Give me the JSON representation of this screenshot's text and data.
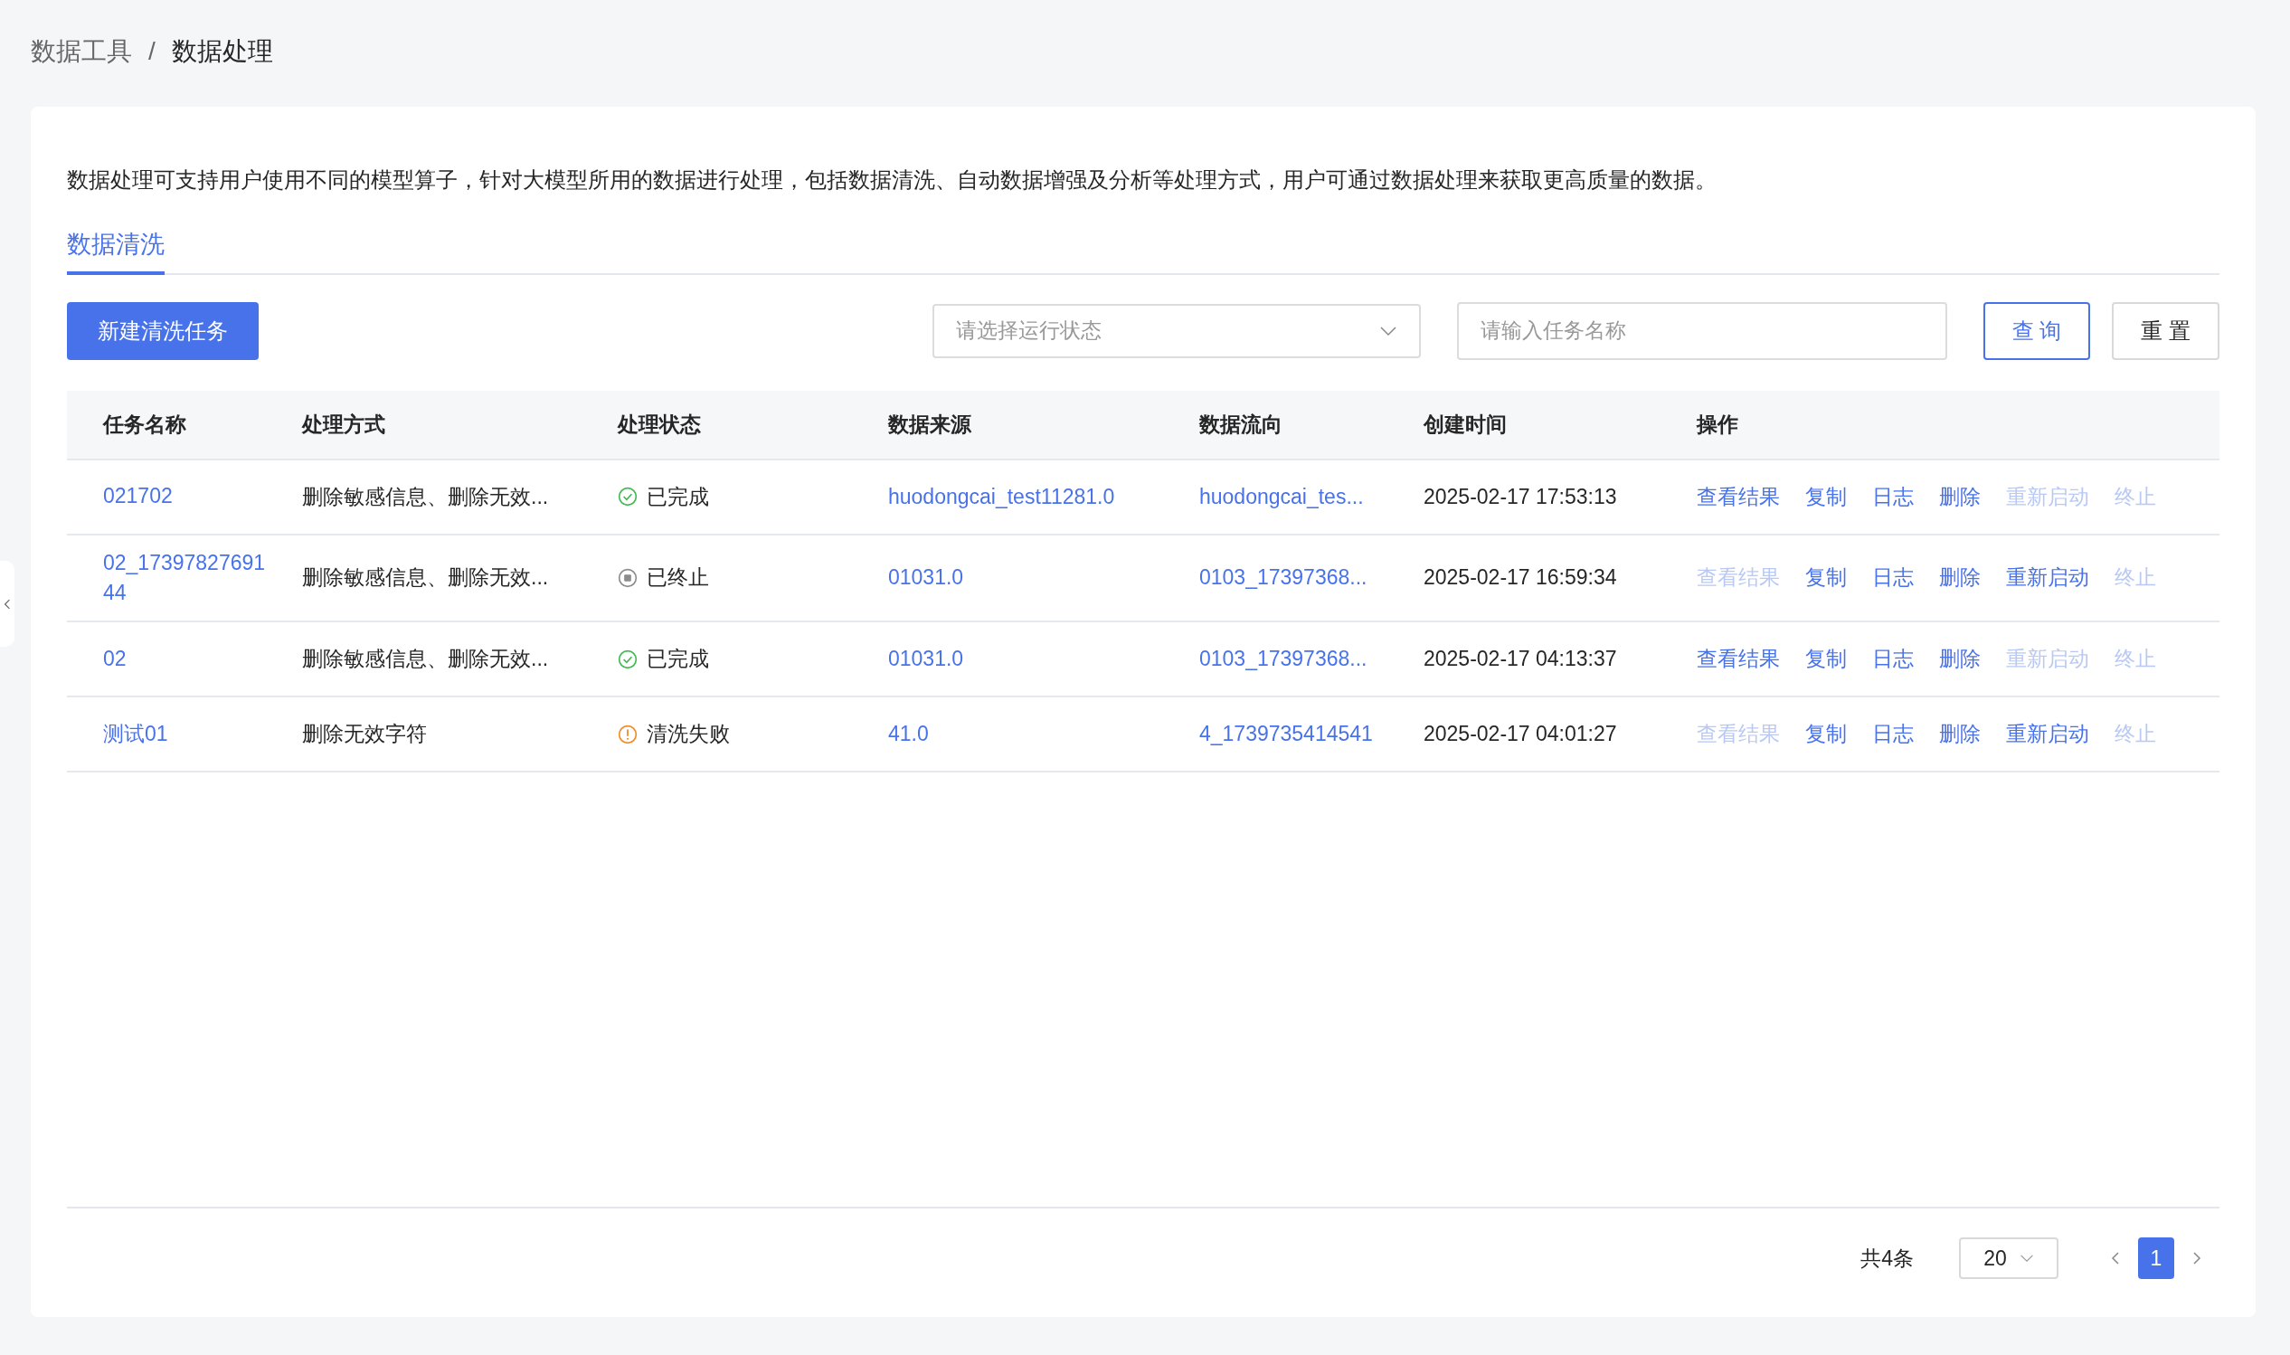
{
  "breadcrumb_separator": "/",
  "breadcrumb": [
    {
      "label": "数据工具",
      "current": false
    },
    {
      "label": "数据处理",
      "current": true
    }
  ],
  "description": "数据处理可支持用户使用不同的模型算子，针对大模型所用的数据进行处理，包括数据清洗、自动数据增强及分析等处理方式，用户可通过数据处理来获取更高质量的数据。",
  "tabs": [
    {
      "label": "数据清洗",
      "selected": true
    }
  ],
  "toolbar": {
    "create_button": "新建清洗任务",
    "status_select": {
      "placeholder": "请选择运行状态"
    },
    "name_search": {
      "placeholder": "请输入任务名称"
    },
    "query_button": "查 询",
    "reset_button": "重 置"
  },
  "table": {
    "columns": [
      "任务名称",
      "处理方式",
      "处理状态",
      "数据来源",
      "数据流向",
      "创建时间",
      "操作"
    ],
    "rows": [
      {
        "name": "021702",
        "method": "删除敏感信息、删除无效...",
        "status": {
          "kind": "done",
          "label": "已完成"
        },
        "source": "huodongcai_test11281.0",
        "target": "huodongcai_tes...",
        "created": "2025-02-17 17:53:13",
        "actions": [
          {
            "label": "查看结果",
            "disabled": false
          },
          {
            "label": "复制",
            "disabled": false
          },
          {
            "label": "日志",
            "disabled": false
          },
          {
            "label": "删除",
            "disabled": false
          },
          {
            "label": "重新启动",
            "disabled": true
          },
          {
            "label": "终止",
            "disabled": true
          }
        ]
      },
      {
        "name": "02_1739782769144",
        "method": "删除敏感信息、删除无效...",
        "status": {
          "kind": "stopped",
          "label": "已终止"
        },
        "source": "01031.0",
        "target": "0103_17397368...",
        "created": "2025-02-17 16:59:34",
        "actions": [
          {
            "label": "查看结果",
            "disabled": true
          },
          {
            "label": "复制",
            "disabled": false
          },
          {
            "label": "日志",
            "disabled": false
          },
          {
            "label": "删除",
            "disabled": false
          },
          {
            "label": "重新启动",
            "disabled": false
          },
          {
            "label": "终止",
            "disabled": true
          }
        ]
      },
      {
        "name": "02",
        "method": "删除敏感信息、删除无效...",
        "status": {
          "kind": "done",
          "label": "已完成"
        },
        "source": "01031.0",
        "target": "0103_17397368...",
        "created": "2025-02-17 04:13:37",
        "actions": [
          {
            "label": "查看结果",
            "disabled": false
          },
          {
            "label": "复制",
            "disabled": false
          },
          {
            "label": "日志",
            "disabled": false
          },
          {
            "label": "删除",
            "disabled": false
          },
          {
            "label": "重新启动",
            "disabled": true
          },
          {
            "label": "终止",
            "disabled": true
          }
        ]
      },
      {
        "name": "测试01",
        "method": "删除无效字符",
        "status": {
          "kind": "failed",
          "label": "清洗失败"
        },
        "source": "41.0",
        "target": "4_1739735414541",
        "created": "2025-02-17 04:01:27",
        "actions": [
          {
            "label": "查看结果",
            "disabled": true
          },
          {
            "label": "复制",
            "disabled": false
          },
          {
            "label": "日志",
            "disabled": false
          },
          {
            "label": "删除",
            "disabled": false
          },
          {
            "label": "重新启动",
            "disabled": false
          },
          {
            "label": "终止",
            "disabled": true
          }
        ]
      }
    ]
  },
  "pagination": {
    "total": "共4条",
    "page_size": "20",
    "pages": [
      {
        "label": "1",
        "selected": true
      }
    ]
  }
}
